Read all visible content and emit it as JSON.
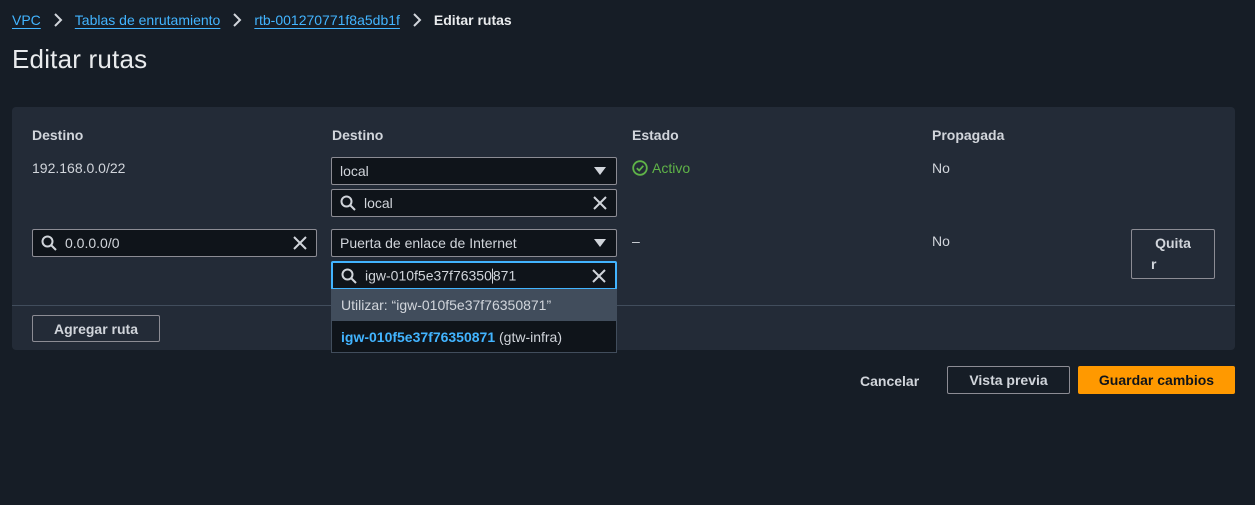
{
  "breadcrumb": {
    "items": [
      "VPC",
      "Tablas de enrutamiento",
      "rtb-001270771f8a5db1f"
    ],
    "current": "Editar rutas"
  },
  "page_title": "Editar rutas",
  "table": {
    "headers": [
      "Destino",
      "Destino",
      "Estado",
      "Propagada"
    ],
    "rows": [
      {
        "destination": "192.168.0.0/22",
        "target_type": "local",
        "target_search": "local",
        "status": "Activo",
        "propagated": "No"
      },
      {
        "destination": "0.0.0.0/0",
        "target_type": "Puerta de enlace de Internet",
        "target_search_before_cursor": "igw-010f5e37f76350",
        "target_search_after_cursor": "871",
        "status": "–",
        "propagated": "No",
        "remove_label_1": "Quita",
        "remove_label_2": "r"
      }
    ]
  },
  "dropdown": {
    "use_option": "Utilizar: “igw-010f5e37f76350871”",
    "option_match": "igw-010f5e37f76350871",
    "option_suffix": " (gtw-infra)"
  },
  "add_route_label": "Agregar ruta",
  "footer": {
    "cancel": "Cancelar",
    "preview": "Vista previa",
    "save": "Guardar cambios"
  },
  "colors": {
    "background": "#161d26",
    "panel": "#232b37",
    "link": "#42b4ff",
    "success": "#5fb348",
    "primary": "#ff9900"
  },
  "icons": [
    "chevron-right-icon",
    "search-icon",
    "clear-icon",
    "caret-down-icon",
    "check-circle-icon"
  ]
}
